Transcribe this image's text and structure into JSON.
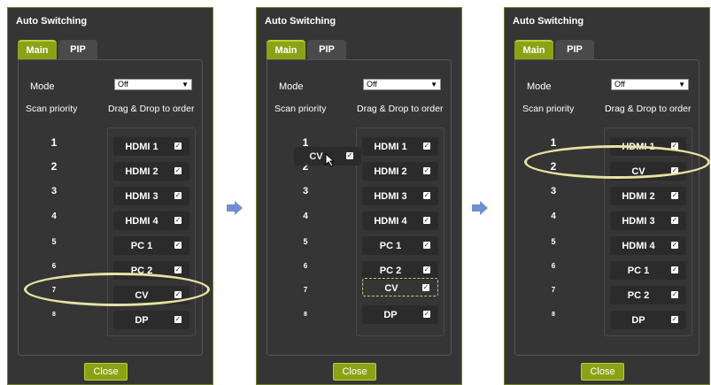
{
  "panels": [
    {
      "title": "Auto Switching",
      "tabs": [
        {
          "label": "Main"
        },
        {
          "label": "PIP"
        }
      ],
      "mode_label": "Mode",
      "mode_value": "Off",
      "scan_priority_label": "Scan priority",
      "drag_label": "Drag & Drop to order",
      "priorities": [
        "1",
        "2",
        "3",
        "4",
        "5",
        "6",
        "7",
        "8"
      ],
      "items": [
        "HDMI 1",
        "HDMI 2",
        "HDMI 3",
        "HDMI 4",
        "PC 1",
        "PC 2",
        "CV",
        "DP"
      ],
      "close_label": "Close"
    },
    {
      "title": "Auto Switching",
      "tabs": [
        {
          "label": "Main"
        },
        {
          "label": "PIP"
        }
      ],
      "mode_label": "Mode",
      "mode_value": "Off",
      "scan_priority_label": "Scan priority",
      "drag_label": "Drag & Drop to order",
      "priorities": [
        "1",
        "2",
        "3",
        "4",
        "5",
        "6",
        "7",
        "8"
      ],
      "items": [
        "HDMI 1",
        "HDMI 2",
        "HDMI 3",
        "HDMI 4",
        "PC 1",
        "PC 2",
        "CV",
        "DP"
      ],
      "dragging_label": "CV",
      "close_label": "Close"
    },
    {
      "title": "Auto Switching",
      "tabs": [
        {
          "label": "Main"
        },
        {
          "label": "PIP"
        }
      ],
      "mode_label": "Mode",
      "mode_value": "Off",
      "scan_priority_label": "Scan priority",
      "drag_label": "Drag & Drop to order",
      "priorities": [
        "1",
        "2",
        "3",
        "4",
        "5",
        "6",
        "7",
        "8"
      ],
      "items": [
        "HDMI 1",
        "CV",
        "HDMI 2",
        "HDMI 3",
        "HDMI 4",
        "PC 1",
        "PC 2",
        "DP"
      ],
      "close_label": "Close"
    }
  ],
  "colors": {
    "accent": "#8aa316",
    "panel_bg": "#353535",
    "item_bg": "#2b2b2b",
    "highlight": "#e7e2a2",
    "arrow": "#6f8fcf"
  },
  "icons": {
    "select_arrow": "▼",
    "checkbox_mark": "✓",
    "step_arrow": "arrow-right-icon",
    "cursor": "mouse-pointer-icon"
  }
}
